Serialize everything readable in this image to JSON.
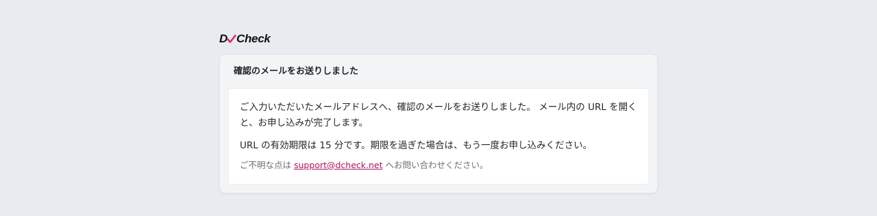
{
  "brand": {
    "logo_prefix": "D",
    "logo_suffix": "Check",
    "check_color": "#e3267a"
  },
  "card": {
    "title": "確認のメールをお送りしました",
    "paragraph1": "ご入力いただいたメールアドレスへ、確認のメールをお送りしました。 メール内の URL を開くと、お申し込みが完了します。",
    "paragraph2": "URL の有効期限は 15 分です。期限を過ぎた場合は、もう一度お申し込みください。",
    "support_prefix": "ご不明な点は ",
    "support_email": "support@dcheck.net",
    "support_suffix": " へお問い合わせください。",
    "link_color": "#b2125c"
  }
}
